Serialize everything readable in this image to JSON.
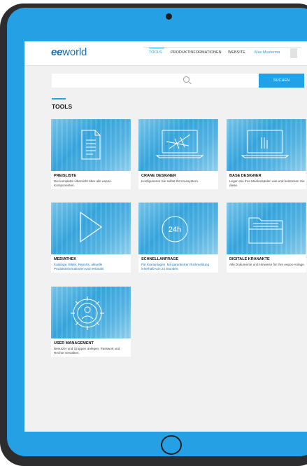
{
  "header": {
    "logo_prefix": "ee",
    "logo_suffix": "world",
    "nav": [
      {
        "label": "TOOLS",
        "active": true
      },
      {
        "label": "PRODUKTINFORMATIONEN",
        "active": false
      },
      {
        "label": "WEBSITE",
        "active": false
      }
    ],
    "user_name": "Max Musterma"
  },
  "search": {
    "placeholder": "",
    "button_label": "SUCHEN"
  },
  "section_title": "TOOLS",
  "tools": [
    {
      "title": "PREISLISTE",
      "description": "Die komplette Übersicht über alle eepos-Komponenten.",
      "icon": "document-icon"
    },
    {
      "title": "CRANE DESIGNER",
      "description": "Konfigurieren Sie selbst Ihr Kransystem.",
      "icon": "laptop-crane-icon"
    },
    {
      "title": "BASE DESIGNER",
      "description": "Legen Sie Ihre Mediensäulen aus und bestücken Sie diese.",
      "icon": "laptop-columns-icon"
    },
    {
      "title": "MEDIATHEK",
      "description": "Kataloge, Bilder, Reports, aktuelle Produktinformationen und eetorials",
      "icon": "play-icon"
    },
    {
      "title": "SCHNELLANFRAGE",
      "description": "Für Krananlagen. Mit garantierter Rückmeldung innerhalb von 24 Stunden.",
      "icon": "clock-24-icon"
    },
    {
      "title": "DIGITALE KRANAKTE",
      "description": "Alle Dokumente und Hinweise für Ihre eepos-Anlage.",
      "icon": "folder-icon"
    },
    {
      "title": "USER MANAGEMENT",
      "description": "Benutzer und Gruppen anlegen, Passwort und Rechte verwalten.",
      "icon": "gear-user-icon"
    }
  ],
  "colors": {
    "accent": "#1fa3e6",
    "tablet_frame": "#26a0e4",
    "brand": "#1a6fb3"
  }
}
